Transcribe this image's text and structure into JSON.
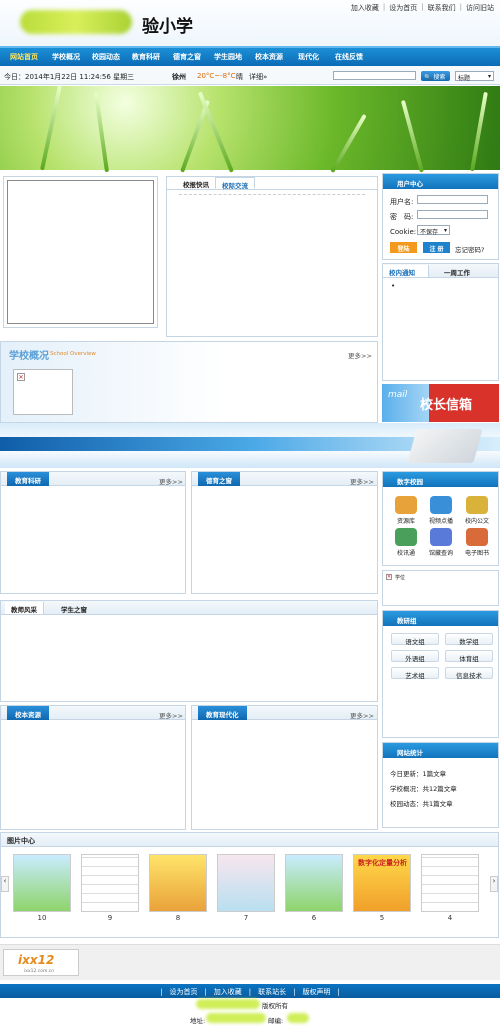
{
  "header": {
    "school_name_suffix": "验小学",
    "toplinks": [
      "加入收藏",
      "设为首页",
      "联系我们",
      "访问旧站"
    ]
  },
  "nav": [
    "网站首页",
    "学校概况",
    "校园动态",
    "教育科研",
    "德育之窗",
    "学生园地",
    "校本资源",
    "现代化",
    "在线反馈"
  ],
  "infobar": {
    "date": "今日：2014年1月22日 11:24:56 星期三",
    "city": "徐州",
    "temp": "20°C~-8°C",
    "weather": "晴",
    "detail": "详细»",
    "search_button": "搜索",
    "search_select": "标题"
  },
  "news": {
    "tab1": "校报快讯",
    "tab2": "校际交流"
  },
  "user_center": {
    "title": "用户中心",
    "username_label": "用户名:",
    "password_label": "密　码:",
    "cookie_label": "Cookie:",
    "cookie_value": "不保存",
    "login": "登陆",
    "register": "注 册",
    "forgot": "忘记密码?"
  },
  "notice": {
    "tab1": "校内通知",
    "tab2": "一周工作",
    "item": "•"
  },
  "overview": {
    "title": "学校概况",
    "subtitle": "School Overview",
    "more": "更多>>"
  },
  "principal_mail": "校长信箱",
  "mail_word": "mail",
  "sections": {
    "research": {
      "title": "教育科研",
      "more": "更多>>"
    },
    "moral": {
      "title": "德育之窗",
      "more": "更多>>"
    },
    "teacher_tab": "教师风采",
    "student_tab": "学生之窗",
    "resources": {
      "title": "校本资源",
      "more": "更多>>"
    },
    "modern": {
      "title": "教育现代化",
      "more": "更多>>"
    }
  },
  "digital_campus": {
    "title": "数字校园",
    "items": [
      {
        "label": "资源库",
        "icon": "library-icon",
        "color": "#e8a23a"
      },
      {
        "label": "视频点播",
        "icon": "video-icon",
        "color": "#3a8fd9"
      },
      {
        "label": "校内公文",
        "icon": "document-icon",
        "color": "#d9b23a"
      },
      {
        "label": "校讯通",
        "icon": "people-icon",
        "color": "#4aa05a"
      },
      {
        "label": "馆藏查询",
        "icon": "search-icon",
        "color": "#5a7ad9"
      },
      {
        "label": "电子图书",
        "icon": "ebook-icon",
        "color": "#d96a3a"
      }
    ]
  },
  "ad_label": "学位",
  "research_groups": {
    "title": "教研组",
    "items": [
      "语文组",
      "数学组",
      "外语组",
      "体育组",
      "艺术组",
      "信息技术"
    ]
  },
  "stats": {
    "title": "网站统计",
    "lines": [
      "今日更新：1篇文章",
      "学校概况：共12篇文章",
      "校园动态：共1篇文章"
    ]
  },
  "gallery": {
    "title": "图片中心",
    "labels": [
      "10",
      "9",
      "8",
      "7",
      "6",
      "5",
      "4"
    ],
    "thumb5_text": "数字化定量分析"
  },
  "partner_logo": "ixx12",
  "partner_url": "ixx12.com.cn",
  "footer": {
    "links": "|　设为首页　|　加入收藏　|　联系站长　|　版权声明　|",
    "copyright": "版权所有",
    "address_label": "地址:",
    "postcode_label": "邮编:"
  },
  "colors": {
    "nav_blue": "#0b6bb5",
    "accent_yellow": "#ffe55a",
    "button_orange": "#f39a1e"
  }
}
